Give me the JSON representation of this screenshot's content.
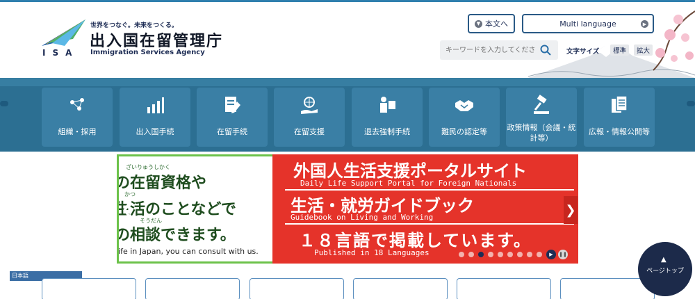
{
  "header": {
    "tagline": "世界をつなぐ。未来をつくる。",
    "title": "出入国在留管理庁",
    "title_en": "Immigration Services Agency",
    "logo_abbr": "ISA",
    "skip_to_main": "本文へ",
    "language_button": "Multi language",
    "search_placeholder": "キーワードを入力してください",
    "font_size_label": "文字サイズ",
    "font_standard": "標準",
    "font_large": "拡大"
  },
  "nav": {
    "items": [
      {
        "label": "組織・採用",
        "icon": "people-network-icon"
      },
      {
        "label": "出入国手続",
        "icon": "bar-chart-icon"
      },
      {
        "label": "在留手続",
        "icon": "document-pen-icon"
      },
      {
        "label": "在留支援",
        "icon": "globe-hand-icon"
      },
      {
        "label": "退去強制手続",
        "icon": "officer-icon"
      },
      {
        "label": "難民の認定等",
        "icon": "handshake-icon"
      },
      {
        "label": "政策情報（会議・統計等）",
        "icon": "gavel-icon"
      },
      {
        "label": "広報・情報公開等",
        "icon": "documents-icon"
      }
    ]
  },
  "banner": {
    "left_ruby_1": "ざいりゅうしかく",
    "left_line_1": "の在留資格や",
    "left_ruby_2": "かつ",
    "left_line_2": "生活のことなどで",
    "left_ruby_3": "そうだん",
    "left_line_3": "の相談できます。",
    "left_en": "life in Japan, you can consult with us.",
    "right_title_1": "外国人生活支援ポータルサイト",
    "right_en_1": "Daily Life Support Portal for Foreign Nationals",
    "right_title_2": "生活・就労ガイドブック",
    "right_en_2": "Guidebook on Living and Working",
    "right_title_3": "１８言語で掲載しています。",
    "right_en_3": "Published in 18 Languages",
    "slide_count": 10,
    "active_slide": 3
  },
  "bottom": {
    "language_tab": "日本語",
    "page_top": "ページトップ"
  },
  "colors": {
    "nav_band": "#2c6f92",
    "nav_tile": "#3a7fa5",
    "banner_red": "#e5332a",
    "banner_green": "#6cc24a",
    "navy": "#1e2d55"
  }
}
